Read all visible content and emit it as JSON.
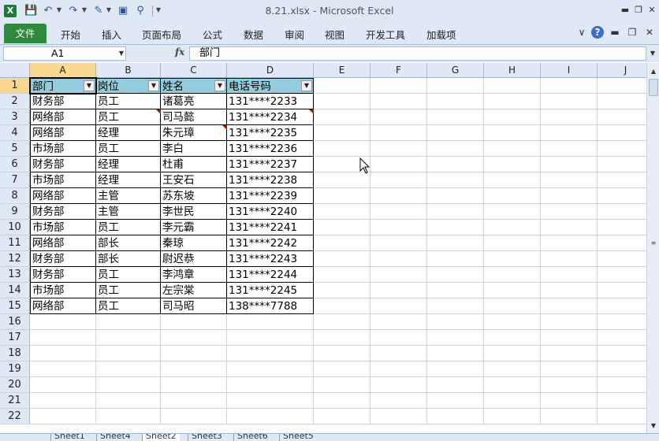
{
  "window": {
    "title": "8.21.xlsx  -  Microsoft Excel",
    "app_icon": "X"
  },
  "ribbon": {
    "file_tab": "文件",
    "tabs": [
      "开始",
      "插入",
      "页面布局",
      "公式",
      "数据",
      "审阅",
      "视图",
      "开发工具",
      "加载项"
    ]
  },
  "formula_bar": {
    "name_box": "A1",
    "fx": "fx",
    "content": "部门"
  },
  "grid": {
    "columns": [
      "A",
      "B",
      "C",
      "D",
      "E",
      "F",
      "G",
      "H",
      "I",
      "J"
    ],
    "rows": [
      "1",
      "2",
      "3",
      "4",
      "5",
      "6",
      "7",
      "8",
      "9",
      "10",
      "11",
      "12",
      "13",
      "14",
      "15",
      "16",
      "17",
      "18",
      "19",
      "20",
      "21",
      "22"
    ],
    "header": [
      "部门",
      "岗位",
      "姓名",
      "电话号码"
    ],
    "data": [
      [
        "财务部",
        "员工",
        "诸葛亮",
        "131****2233"
      ],
      [
        "网络部",
        "员工",
        "司马懿",
        "131****2234"
      ],
      [
        "网络部",
        "经理",
        "朱元璋",
        "131****2235"
      ],
      [
        "市场部",
        "员工",
        "李白",
        "131****2236"
      ],
      [
        "财务部",
        "经理",
        "杜甫",
        "131****2237"
      ],
      [
        "市场部",
        "经理",
        "王安石",
        "131****2238"
      ],
      [
        "网络部",
        "主管",
        "苏东坡",
        "131****2239"
      ],
      [
        "财务部",
        "主管",
        "李世民",
        "131****2240"
      ],
      [
        "市场部",
        "员工",
        "李元霸",
        "131****2241"
      ],
      [
        "网络部",
        "部长",
        "秦琼",
        "131****2242"
      ],
      [
        "财务部",
        "部长",
        "尉迟恭",
        "131****2243"
      ],
      [
        "财务部",
        "员工",
        "李鸿章",
        "131****2244"
      ],
      [
        "市场部",
        "员工",
        "左宗棠",
        "131****2245"
      ],
      [
        "网络部",
        "员工",
        "司马昭",
        "138****7788"
      ]
    ]
  },
  "sheets": [
    "Sheet1",
    "Sheet4",
    "Sheet2",
    "Sheet3",
    "Sheet6",
    "Sheet5"
  ],
  "active_sheet": "Sheet2",
  "colors": {
    "header_fill": "#93cddd",
    "file_tab": "#2e8a3e",
    "selected_header": "#f8d78e",
    "comment_marker": "#cc0000"
  }
}
